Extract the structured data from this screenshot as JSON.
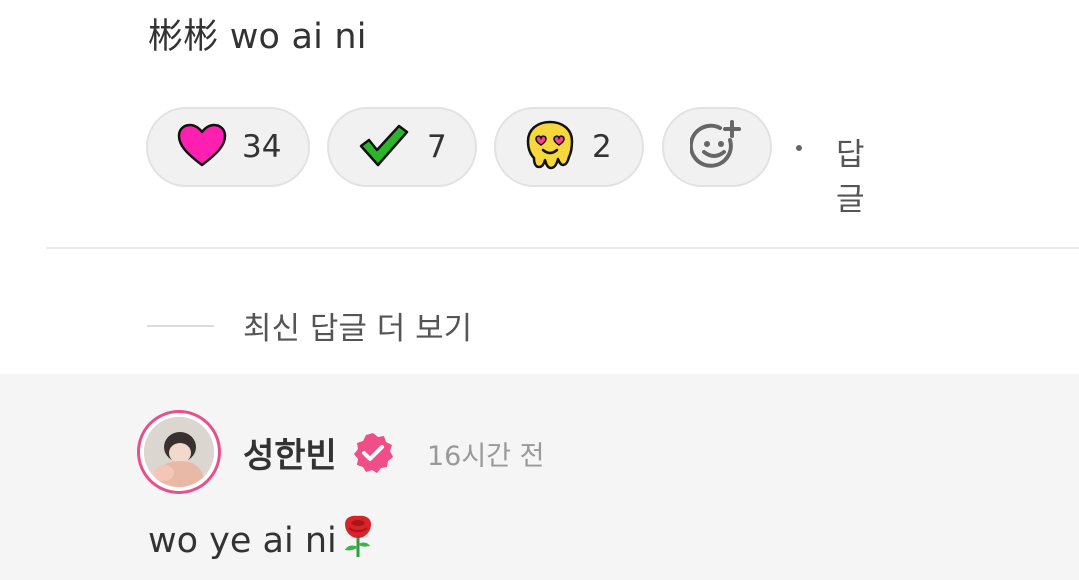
{
  "comment": {
    "text": "彬彬 wo ai ni"
  },
  "reactions": [
    {
      "icon": "pink-heart-icon",
      "count": "34"
    },
    {
      "icon": "green-check-icon",
      "count": "7"
    },
    {
      "icon": "melting-heart-eyes-icon",
      "count": "2"
    }
  ],
  "add_reaction_icon": "add-emoji-icon",
  "reply_label": "답글",
  "more_replies_label": "최신 답글 더 보기",
  "reply": {
    "author": "성한빈",
    "verified_icon": "verified-badge-icon",
    "time": "16시간 전",
    "text": "wo ye ai ni",
    "emoji": "rose-icon"
  },
  "colors": {
    "heart": "#ff1fb0",
    "check": "#2bb52b",
    "melt": "#f6d73c",
    "verified": "#ef4f86",
    "avatar_ring": "#e8508a",
    "reply_bg": "#f5f5f5"
  }
}
